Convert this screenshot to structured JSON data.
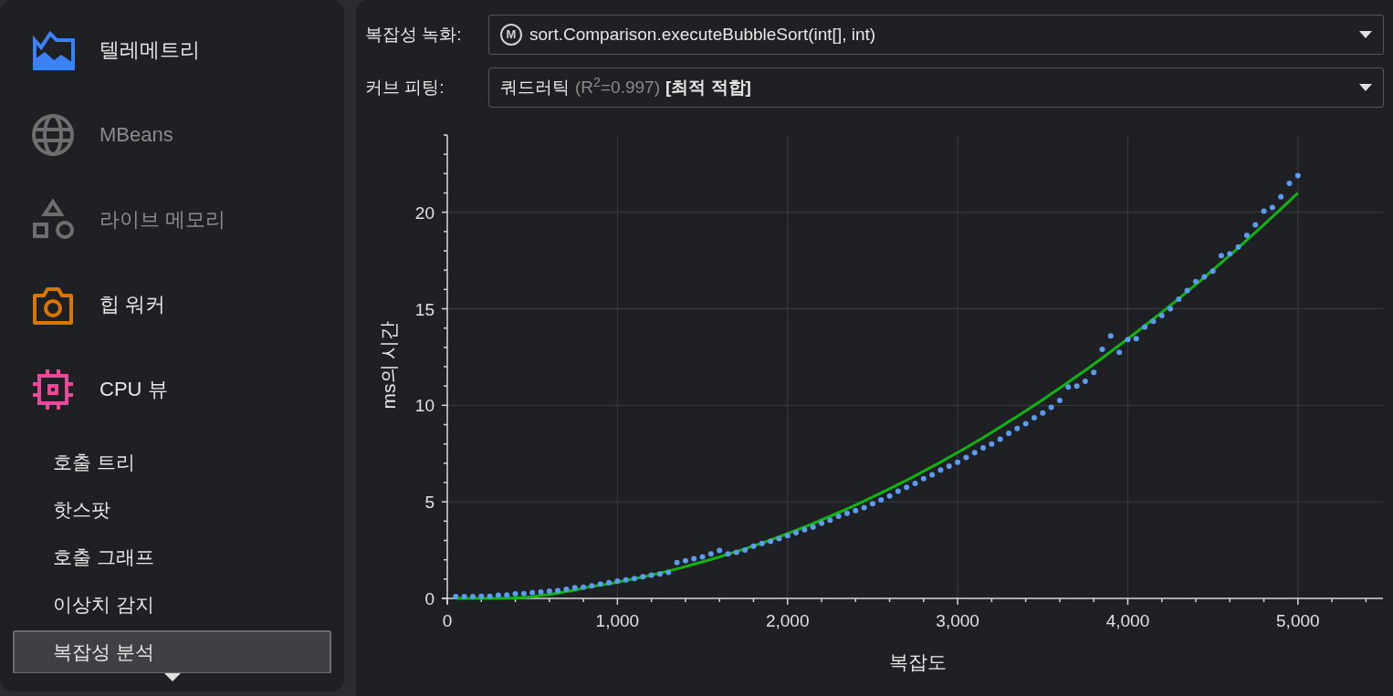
{
  "sidebar": {
    "items": [
      {
        "label": "텔레메트리",
        "disabled": false
      },
      {
        "label": "MBeans",
        "disabled": true
      },
      {
        "label": "라이브 메모리",
        "disabled": true
      },
      {
        "label": "힙 워커",
        "disabled": false
      },
      {
        "label": "CPU 뷰",
        "disabled": false,
        "children": [
          {
            "label": "호출 트리",
            "selected": false
          },
          {
            "label": "핫스팟",
            "selected": false
          },
          {
            "label": "호출 그래프",
            "selected": false
          },
          {
            "label": "이상치 감지",
            "selected": false
          },
          {
            "label": "복잡성 분석",
            "selected": true
          }
        ]
      }
    ]
  },
  "recording": {
    "label": "복잡성 녹화:",
    "badge": "M",
    "value": "sort.Comparison.executeBubbleSort(int[], int)"
  },
  "curve_fitting": {
    "label": "커브 피팅:",
    "fit_name": "쿼드러틱",
    "score": "(R$^{2}$=0.997)",
    "tag": "[최적 적합]"
  },
  "chart": {
    "chart_data": {
      "type": "scatter",
      "xlabel": "복잡도",
      "ylabel": "ms의 시간",
      "xlim": [
        0,
        5500
      ],
      "ylim": [
        0,
        24
      ],
      "grid": true,
      "xticks": [
        0,
        {
          "value": 1000,
          "label": "1,000"
        },
        {
          "value": 2000,
          "label": "2,000"
        },
        {
          "value": 3000,
          "label": "3,000"
        },
        {
          "value": 4000,
          "label": "4,000"
        },
        {
          "value": 5000,
          "label": "5,000"
        }
      ],
      "yticks": [
        0,
        5,
        10,
        15,
        20
      ],
      "x": [
        50,
        100,
        150,
        200,
        250,
        300,
        350,
        400,
        450,
        500,
        550,
        600,
        650,
        700,
        750,
        800,
        850,
        900,
        950,
        1000,
        1050,
        1100,
        1150,
        1200,
        1250,
        1300,
        1350,
        1400,
        1450,
        1500,
        1550,
        1600,
        1650,
        1700,
        1750,
        1800,
        1850,
        1900,
        1950,
        2000,
        2050,
        2100,
        2150,
        2200,
        2250,
        2300,
        2350,
        2400,
        2450,
        2500,
        2550,
        2600,
        2650,
        2700,
        2750,
        2800,
        2850,
        2900,
        2950,
        3000,
        3050,
        3100,
        3150,
        3200,
        3250,
        3300,
        3350,
        3400,
        3450,
        3500,
        3550,
        3600,
        3650,
        3700,
        3750,
        3800,
        3850,
        3900,
        3950,
        4000,
        4050,
        4100,
        4150,
        4200,
        4250,
        4300,
        4350,
        4400,
        4450,
        4500,
        4550,
        4600,
        4650,
        4700,
        4750,
        4800,
        4850,
        4900,
        4950,
        5000
      ],
      "series": [
        {
          "color": "#5b9cf0",
          "values": [
            0.1,
            0.1,
            0.1,
            0.11,
            0.11,
            0.16,
            0.18,
            0.24,
            0.25,
            0.3,
            0.33,
            0.38,
            0.4,
            0.47,
            0.55,
            0.58,
            0.65,
            0.74,
            0.82,
            0.9,
            0.96,
            1.03,
            1.12,
            1.2,
            1.26,
            1.35,
            1.85,
            1.95,
            2.05,
            2.15,
            2.3,
            2.48,
            2.3,
            2.38,
            2.5,
            2.7,
            2.85,
            2.95,
            3.1,
            3.25,
            3.4,
            3.55,
            3.7,
            3.9,
            4.05,
            4.25,
            4.4,
            4.55,
            4.7,
            4.9,
            5.1,
            5.3,
            5.55,
            5.75,
            5.95,
            6.2,
            6.4,
            6.65,
            6.85,
            7.05,
            7.3,
            7.55,
            7.8,
            8.0,
            8.25,
            8.55,
            8.8,
            9.05,
            9.35,
            9.6,
            9.9,
            10.25,
            10.95,
            11.0,
            11.25,
            11.7,
            12.9,
            13.6,
            12.75,
            13.4,
            13.45,
            14.05,
            14.35,
            14.65,
            15.0,
            15.5,
            15.95,
            16.4,
            16.65,
            16.95,
            17.75,
            17.85,
            18.2,
            18.8,
            19.35,
            20.05,
            20.25,
            20.8,
            21.5,
            21.9
          ]
        },
        {
          "type": "line",
          "color": "#12b312",
          "values": [
            0,
            0,
            0,
            0,
            0,
            0,
            0.01,
            0.03,
            0.05,
            0.08,
            0.15,
            0.2,
            0.27,
            0.35,
            0.42,
            0.54,
            0.61,
            0.68,
            0.76,
            0.84,
            0.93,
            1.02,
            1.11,
            1.21,
            1.31,
            1.42,
            1.53,
            1.65,
            1.77,
            1.89,
            2.02,
            2.15,
            2.29,
            2.43,
            2.57,
            2.72,
            2.87,
            3.03,
            3.19,
            3.36,
            3.53,
            3.7,
            3.88,
            4.07,
            4.25,
            4.44,
            4.64,
            4.84,
            5.04,
            5.25,
            5.46,
            5.68,
            5.9,
            6.12,
            6.35,
            6.59,
            6.82,
            7.06,
            7.31,
            7.56,
            7.81,
            8.07,
            8.33,
            8.6,
            8.87,
            9.15,
            9.43,
            9.71,
            10.0,
            10.29,
            10.59,
            10.89,
            11.19,
            11.5,
            11.81,
            12.13,
            12.45,
            12.78,
            13.11,
            13.44,
            13.78,
            14.12,
            14.47,
            14.82,
            15.17,
            15.53,
            15.89,
            16.26,
            16.63,
            17.01,
            17.39,
            17.77,
            18.16,
            18.56,
            18.95,
            19.35,
            19.76,
            20.17,
            20.58,
            21.0
          ]
        }
      ]
    }
  }
}
